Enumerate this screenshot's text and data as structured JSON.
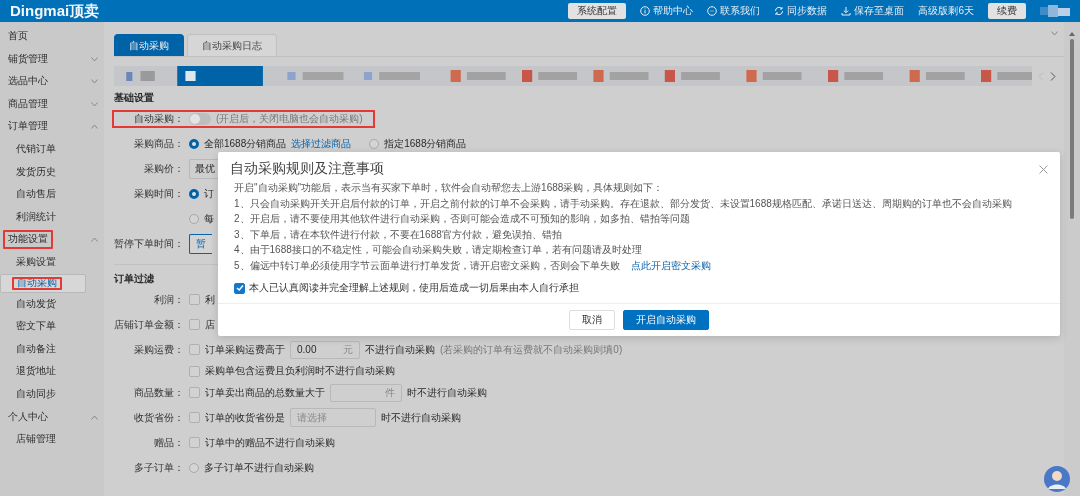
{
  "header": {
    "logo": "Dingmai顶卖",
    "config_button": "系统配置",
    "links": [
      {
        "kind": "help",
        "label": "帮助中心"
      },
      {
        "kind": "contact",
        "label": "联系我们"
      },
      {
        "kind": "sync",
        "label": "同步数据"
      },
      {
        "kind": "save",
        "label": "保存至桌面"
      }
    ],
    "plan": "高级版剩6天",
    "renew_button": "续费"
  },
  "sidebar": {
    "items": [
      {
        "label": "首页",
        "selected": false,
        "highlighted": false
      },
      {
        "label": "铺货管理",
        "expanded": false,
        "selected": false,
        "highlighted": false
      },
      {
        "label": "选品中心",
        "expanded": false,
        "selected": false,
        "highlighted": false
      },
      {
        "label": "商品管理",
        "expanded": false,
        "selected": false,
        "highlighted": false
      },
      {
        "label": "订单管理",
        "expanded": true,
        "selected": false,
        "highlighted": false,
        "children": [
          {
            "label": "代销订单",
            "selected": false,
            "highlighted": false
          },
          {
            "label": "发货历史",
            "selected": false,
            "highlighted": false
          },
          {
            "label": "自动售后",
            "selected": false,
            "highlighted": false
          },
          {
            "label": "利润统计",
            "selected": false,
            "highlighted": false
          }
        ]
      },
      {
        "label": "功能设置",
        "expanded": true,
        "selected": false,
        "highlighted": true,
        "children": [
          {
            "label": "采购设置",
            "selected": false,
            "highlighted": false
          },
          {
            "label": "自动采购",
            "selected": true,
            "highlighted": true
          },
          {
            "label": "自动发货",
            "selected": false,
            "highlighted": false
          },
          {
            "label": "密文下单",
            "selected": false,
            "highlighted": false
          },
          {
            "label": "自动备注",
            "selected": false,
            "highlighted": false
          },
          {
            "label": "退货地址",
            "selected": false,
            "highlighted": false
          },
          {
            "label": "自动同步",
            "selected": false,
            "highlighted": false
          }
        ]
      },
      {
        "label": "个人中心",
        "expanded": true,
        "selected": false,
        "highlighted": false,
        "children": [
          {
            "label": "店铺管理",
            "selected": false,
            "highlighted": false
          }
        ]
      }
    ]
  },
  "tabs": [
    {
      "label": "自动采购",
      "selected": true
    },
    {
      "label": "自动采购日志",
      "selected": false
    }
  ],
  "basic": {
    "title": "基础设置",
    "auto": {
      "label": "自动采购：",
      "on": false,
      "hint": "(开启后，关闭电脑也会自动采购)",
      "highlighted": true
    },
    "goods": {
      "label": "采购商品：",
      "options": [
        {
          "label": "全部1688分销商品",
          "selected": true
        },
        {
          "label": "指定1688分销商品",
          "selected": false
        }
      ],
      "link": "选择过滤商品"
    },
    "price": {
      "label": "采购价：",
      "value": "最优"
    },
    "time": {
      "label": "采购时间：",
      "options": [
        {
          "label": "订",
          "selected": true
        },
        {
          "label": "每",
          "selected": false
        }
      ]
    },
    "pause": {
      "label": "暂停下单时间：",
      "button": "暂"
    }
  },
  "filter": {
    "title": "订单过滤",
    "rows": [
      {
        "kind": "checkbox",
        "label": "利润：",
        "checked": false,
        "text": "利"
      },
      {
        "kind": "checkbox",
        "label": "店铺订单金额：",
        "checked": false,
        "text": "店"
      },
      {
        "kind": "input",
        "label": "采购运费：",
        "checked": false,
        "text": "订单采购运费高于",
        "value": "0.00",
        "unit": "元",
        "after": "不进行自动采购",
        "note": "(若采购的订单有运费就不自动采购则填0)"
      },
      {
        "kind": "checkbox",
        "checked": false,
        "text": "采购单包含运费且负利润时不进行自动采购"
      },
      {
        "kind": "input",
        "label": "商品数量：",
        "checked": false,
        "text": "订单卖出商品的总数量大于",
        "unit": "件",
        "after": "时不进行自动采购"
      },
      {
        "kind": "select",
        "label": "收货省份：",
        "checked": false,
        "text": "订单的收货省份是",
        "placeholder": "请选择",
        "after": "时不进行自动采购"
      },
      {
        "kind": "checkbox",
        "label": "赠品：",
        "checked": false,
        "text": "订单中的赠品不进行自动采购"
      },
      {
        "kind": "radio",
        "label": "多子订单：",
        "selected": false,
        "text": "多子订单不进行自动采购"
      }
    ]
  },
  "modal": {
    "title": "自动采购规则及注意事项",
    "intro": "开启\"自动采购\"功能后，表示当有买家下单时，软件会自动帮您去上游1688采购，具体规则如下：",
    "rules": [
      {
        "text": "1、只会自动采购开关开启后付款的订单，开启之前付款的订单不会采购，请手动采购。存在退款、部分发货、未设置1688规格匹配、承诺日送达、周期购的订单也不会自动采购"
      },
      {
        "text": "2、开启后，请不要使用其他软件进行自动采购，否则可能会造成不可预知的影响，如多拍、错拍等问题"
      },
      {
        "text": "3、下单后，请在本软件进行付款，不要在1688官方付款，避免误拍、错拍"
      },
      {
        "text": "4、由于1688接口的不稳定性，可能会自动采购失败，请定期检查订单，若有问题请及时处理"
      },
      {
        "text": "5、偏远中转订单必须使用字节云面单进行打单发货，请开启密文采购，否则会下单失败",
        "link": "点此开启密文采购"
      }
    ],
    "agree": {
      "label": "本人已认真阅读并完全理解上述规则，使用后造成一切后果由本人自行承担",
      "checked": true
    },
    "buttons": [
      {
        "label": "取消",
        "kind": "default"
      },
      {
        "label": "开启自动采购",
        "kind": "primary"
      }
    ]
  }
}
